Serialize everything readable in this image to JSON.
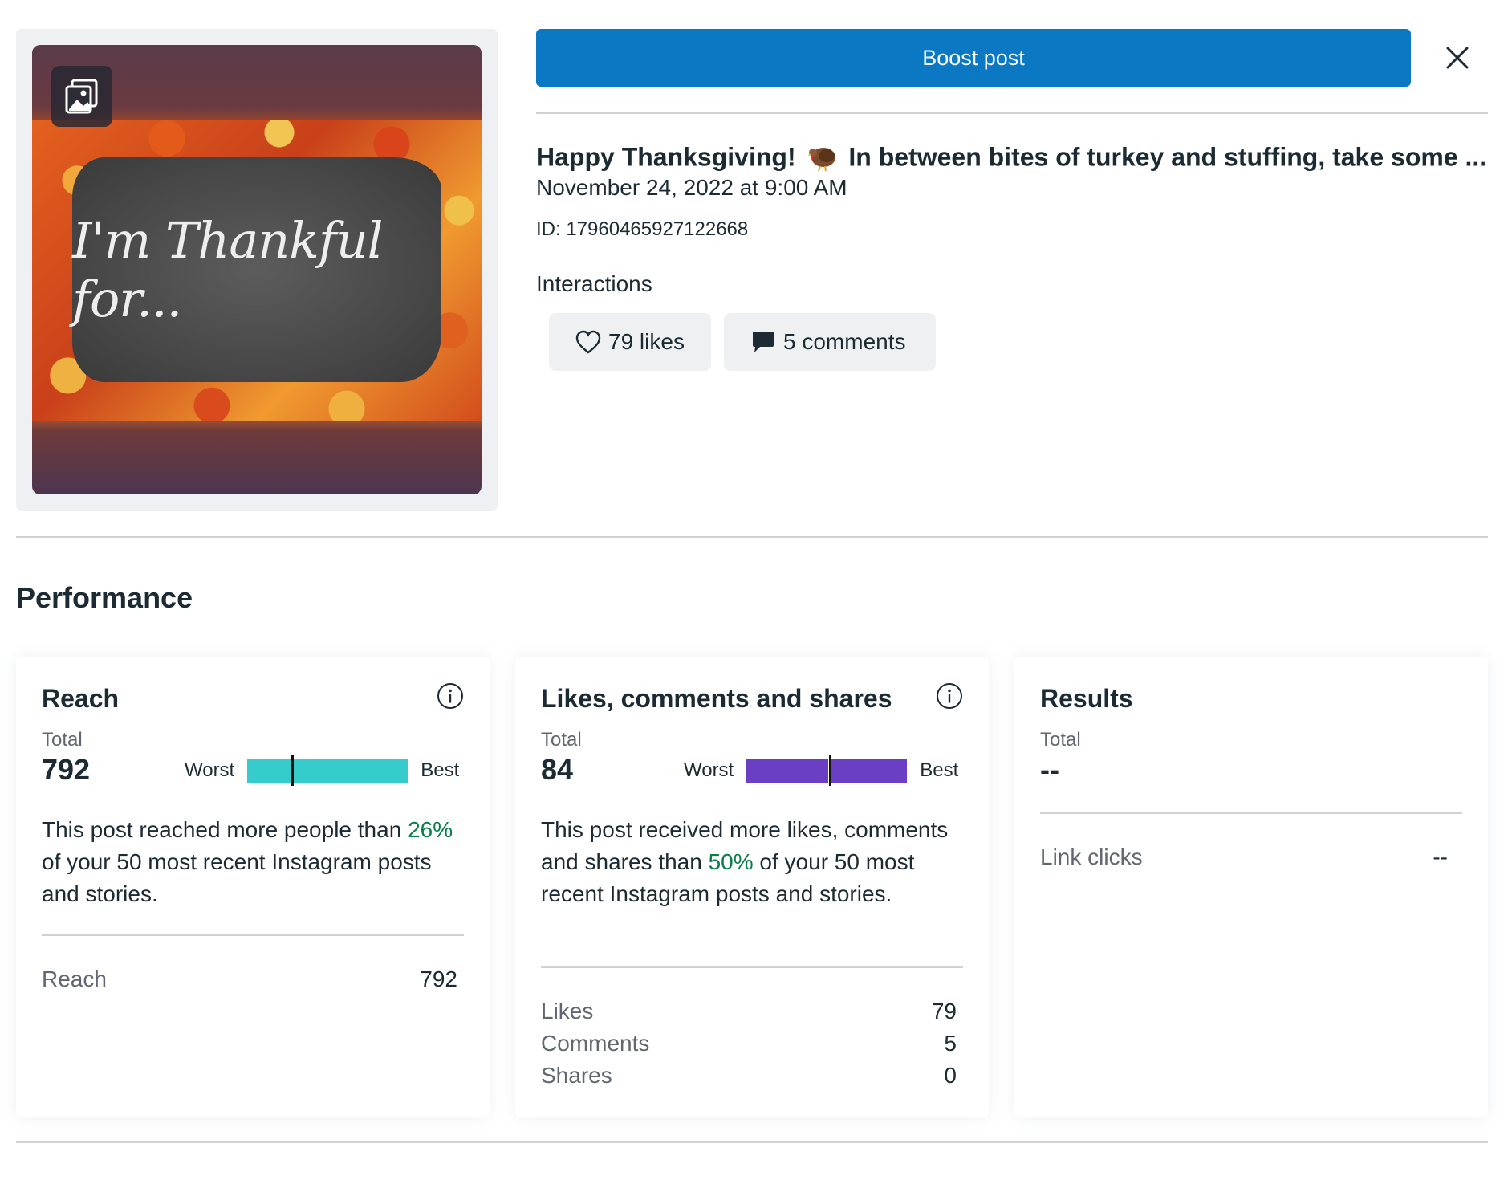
{
  "header": {
    "boost_label": "Boost post"
  },
  "post": {
    "title_start": "Happy Thanksgiving!",
    "title_end": "In between bites of turkey and stuffing, take some ...",
    "date": "November 24, 2022 at 9:00 AM",
    "id_text": "ID: 17960465927122668",
    "image_text": "I'm Thankful for..."
  },
  "interactions": {
    "label": "Interactions",
    "likes": "79 likes",
    "comments": "5 comments"
  },
  "performance": {
    "title": "Performance",
    "reach": {
      "title": "Reach",
      "total_label": "Total",
      "total_value": "792",
      "worst_label": "Worst",
      "best_label": "Best",
      "percentile": 0.28,
      "bar_color": "#36cccc",
      "desc_pre": "This post reached more people than ",
      "desc_pct": "26%",
      "desc_post": " of your 50 most recent Instagram posts and stories.",
      "rows": [
        {
          "label": "Reach",
          "value": "792"
        }
      ]
    },
    "engagement": {
      "title": "Likes, comments and shares",
      "total_label": "Total",
      "total_value": "84",
      "worst_label": "Worst",
      "best_label": "Best",
      "percentile": 0.52,
      "bar_color": "#6a3fc4",
      "desc_pre": "This post received more likes, comments and shares than ",
      "desc_pct": "50%",
      "desc_post": " of your 50 most recent Instagram posts and stories.",
      "rows": [
        {
          "label": "Likes",
          "value": "79"
        },
        {
          "label": "Comments",
          "value": "5"
        },
        {
          "label": "Shares",
          "value": "0"
        }
      ]
    },
    "results": {
      "title": "Results",
      "total_label": "Total",
      "total_value": "--",
      "rows": [
        {
          "label": "Link clicks",
          "value": "--"
        }
      ]
    }
  },
  "colors": {
    "accent": "#0a78c2",
    "positive": "#0a7e4a"
  }
}
